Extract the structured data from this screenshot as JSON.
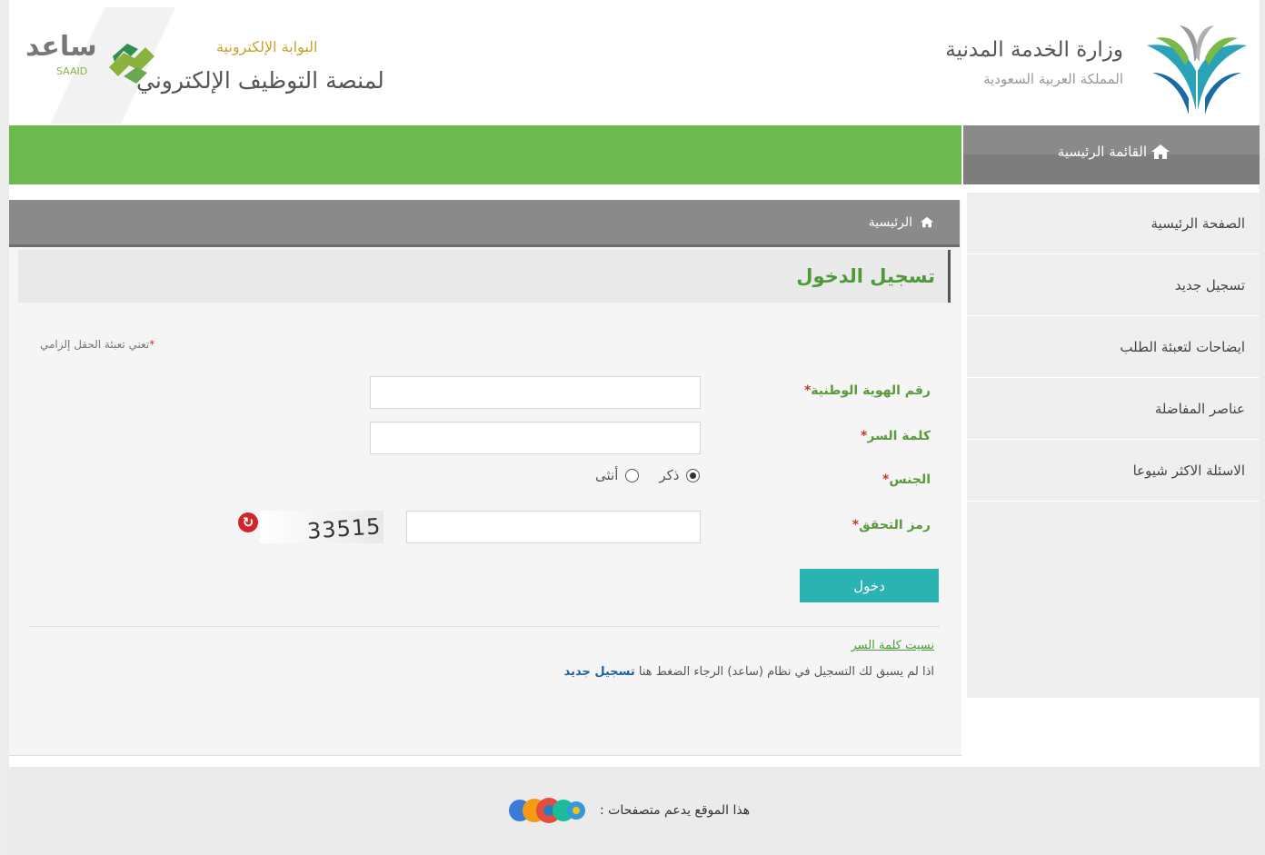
{
  "header": {
    "ministry_title": "وزارة الخدمة المدنية",
    "ministry_subtitle": "المملكة العربية السعودية",
    "saaid_ar": "ساعد",
    "saaid_en": "SAAID",
    "portal_small": "البوابة الإلكترونية",
    "portal_big": "لمنصة التوظيف الإلكتروني"
  },
  "menu": {
    "header_label": "القائمة الرئيسية",
    "items": [
      {
        "label": "الصفحة الرئيسية"
      },
      {
        "label": "تسجيل جديد"
      },
      {
        "label": "ايضاحات لتعبئة الطلب"
      },
      {
        "label": "عناصر المفاضلة"
      },
      {
        "label": "الاسئلة الاكثر شيوعا"
      }
    ]
  },
  "breadcrumb": {
    "home_label": "الرئيسية"
  },
  "page": {
    "title": "تسجيل الدخول",
    "required_note": "تعني تعبئة الحقل إلزامي"
  },
  "form": {
    "national_id_label": "رقم الهوية الوطنية",
    "national_id_value": "",
    "password_label": "كلمة السر",
    "password_value": "",
    "gender_label": "الجنس",
    "gender_options": [
      "ذكر",
      "أنثى"
    ],
    "gender_selected": "ذكر",
    "captcha_label": "رمز التحقق",
    "captcha_value": "",
    "captcha_code": "33515",
    "required_mark": "*",
    "login_button": "دخول"
  },
  "links": {
    "forgot_password": "نسيت كلمة السر",
    "register_prefix": "اذا لم يسبق لك التسجيل في نظام (ساعد) الرجاء الضغط هنا",
    "register_link": "تسجيل جديد"
  },
  "footer": {
    "browsers_text": "هذا الموقع يدعم متصفحات :"
  },
  "colors": {
    "green": "#6cb94f",
    "teal_button": "#2bb3b1",
    "gray_bar": "#8a8a8a",
    "label_green": "#5a9a3c"
  },
  "icons": [
    "home-icon",
    "refresh-icon",
    "browser-icons"
  ]
}
